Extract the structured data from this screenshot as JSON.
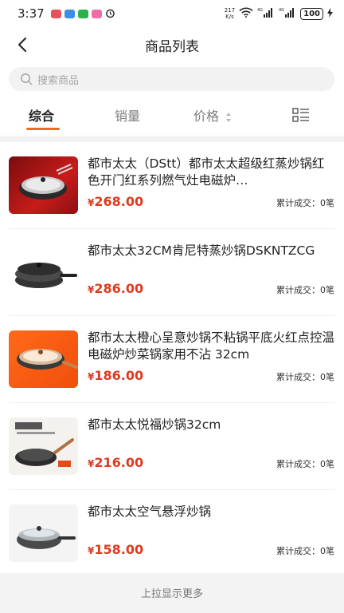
{
  "status_bar": {
    "time": "3:37",
    "speed_value": "217",
    "speed_unit": "K/s",
    "battery": "100",
    "app_icons": [
      "mail-app-icon",
      "mail-blue-icon",
      "wechat-icon",
      "chat-pink-icon",
      "alarm-icon"
    ],
    "signal_icons": [
      "wifi-icon",
      "signal-4g-icon",
      "signal-4g-2-icon",
      "charging-icon"
    ]
  },
  "header": {
    "title": "商品列表",
    "back_icon": "back-arrow-icon"
  },
  "search": {
    "placeholder": "搜索商品",
    "icon": "search-icon"
  },
  "tabs": [
    {
      "label": "综合",
      "active": true
    },
    {
      "label": "销量",
      "active": false
    },
    {
      "label": "价格",
      "active": false
    }
  ],
  "view_toggle_icon": "list-view-icon",
  "products": [
    {
      "name": "都市太太（DStt）都市太太超级红蒸炒锅红色开门红系列燃气灶电磁炉…",
      "currency": "¥",
      "price": "268.00",
      "sold": "累计成交：0笔",
      "image": "red-steam-wok-image"
    },
    {
      "name": "都市太太32CM肯尼特蒸炒锅DSKNTZCG",
      "currency": "¥",
      "price": "286.00",
      "sold": "累计成交：0笔",
      "image": "black-steam-wok-image"
    },
    {
      "name": "都市太太橙心呈意炒锅不粘锅平底火红点控温电磁炉炒菜锅家用不沾 32cm",
      "currency": "¥",
      "price": "186.00",
      "sold": "累计成交：0笔",
      "image": "orange-wok-image"
    },
    {
      "name": "都市太太悦福炒锅32cm",
      "currency": "¥",
      "price": "216.00",
      "sold": "累计成交：0笔",
      "image": "yuefu-wok-image"
    },
    {
      "name": "都市太太空气悬浮炒锅",
      "currency": "¥",
      "price": "158.00",
      "sold": "累计成交：0笔",
      "image": "air-float-wok-image"
    }
  ],
  "footer": {
    "text": "上拉显示更多"
  },
  "colors": {
    "accent": "#f06a1d",
    "price": "#e03a20",
    "background": "#f3f3f3"
  }
}
